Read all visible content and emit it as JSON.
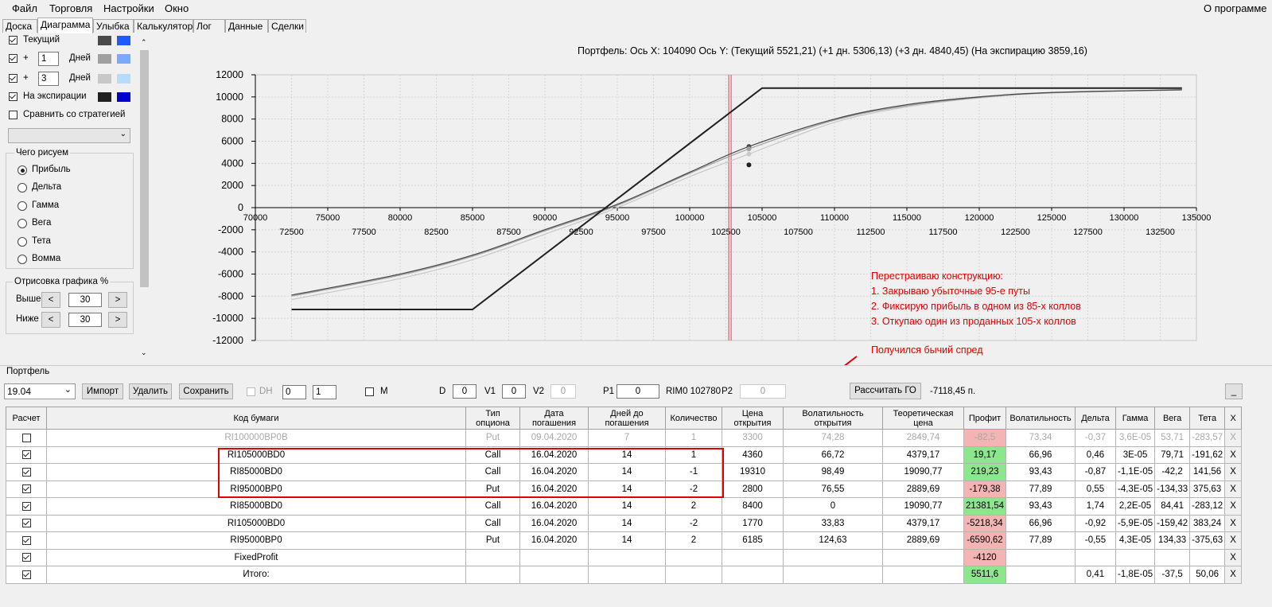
{
  "menu": {
    "file": "Файл",
    "trade": "Торговля",
    "settings": "Настройки",
    "window": "Окно",
    "about": "О программе"
  },
  "tabs": [
    "Доска",
    "Диаграмма",
    "Улыбка",
    "Калькулятор",
    "Лог",
    "Данные",
    "Сделки"
  ],
  "left": {
    "current_label": "Текущий",
    "plus": "+",
    "days1": "1",
    "days_label": "Дней",
    "days2": "3",
    "expiry_label": "На экспирации",
    "compare_label": "Сравнить со стратегией",
    "what_draw": "Чего рисуем",
    "radios": [
      "Прибыль",
      "Дельта",
      "Гамма",
      "Вега",
      "Тета",
      "Вомма"
    ],
    "render_pct": "Отрисовка графика %",
    "above_label": "Выше",
    "above_val": "30",
    "below_label": "Ниже",
    "below_val": "30",
    "lt": "<",
    "gt": ">",
    "colors": {
      "current_dark": "#4a4a4a",
      "current_light": "#1e5aff",
      "d1_dark": "#a0a0a0",
      "d1_light": "#7aaaff",
      "d3_dark": "#c8c8c8",
      "d3_light": "#b4dcff",
      "exp_dark": "#202020",
      "exp_light": "#0000d0"
    }
  },
  "chart_header": "Портфель: Ось X: 104090 Ось Y:  (Текущий 5521,21)  (+1 дн. 5306,13)  (+3 дн. 4840,45)  (На экспирацию 3859,16)",
  "annotation": {
    "lines": [
      "Перестраиваю конструкцию:",
      "1. Закрываю убыточные 95-е путы",
      "2. Фиксирую прибыль в одном из 85-х коллов",
      "3. Откупаю один из проданных 105-х коллов"
    ],
    "result": "Получился бычий спред"
  },
  "chart_data": {
    "type": "line",
    "xlim": [
      70000,
      135000
    ],
    "ylim": [
      -12000,
      12000
    ],
    "x_ticks_top": [
      "70000",
      "75000",
      "80000",
      "85000",
      "90000",
      "95000",
      "100000",
      "105000",
      "110000",
      "115000",
      "120000",
      "125000",
      "130000",
      "135000"
    ],
    "x_ticks_bottom": [
      "72500",
      "77500",
      "82500",
      "87500",
      "92500",
      "97500",
      "102500",
      "107500",
      "112500",
      "117500",
      "122500",
      "127500",
      "132500"
    ],
    "y_ticks": [
      "12000",
      "10000",
      "8000",
      "6000",
      "4000",
      "2000",
      "0",
      "-2000",
      "-4000",
      "-6000",
      "-8000",
      "-10000",
      "-12000"
    ],
    "series": [
      {
        "name": "На экспирации",
        "x": [
          72500,
          85000,
          105000,
          134000
        ],
        "y": [
          -9200,
          -9200,
          10800,
          10800
        ]
      },
      {
        "name": "Текущий",
        "x": [
          72500,
          80000,
          85000,
          90000,
          95000,
          100000,
          104090,
          110000,
          115000,
          120000,
          125000,
          134000
        ],
        "y": [
          -7900,
          -6000,
          -4300,
          -2000,
          300,
          3200,
          5521,
          8000,
          9300,
          10000,
          10400,
          10650
        ]
      },
      {
        "name": "+1 дн.",
        "x": [
          72500,
          80000,
          85000,
          90000,
          95000,
          100000,
          104090,
          110000,
          115000,
          120000,
          125000,
          134000
        ],
        "y": [
          -8000,
          -6100,
          -4400,
          -2100,
          200,
          3100,
          5306,
          7900,
          9200,
          9950,
          10380,
          10640
        ]
      },
      {
        "name": "+3 дн.",
        "x": [
          72500,
          80000,
          85000,
          90000,
          95000,
          100000,
          104090,
          110000,
          115000,
          120000,
          125000,
          134000
        ],
        "y": [
          -8300,
          -6400,
          -4700,
          -2400,
          0,
          2800,
          4840,
          7700,
          9100,
          9900,
          10350,
          10630
        ]
      }
    ],
    "cursor_x": 104090,
    "spot_line_x": 102780
  },
  "portfolio": {
    "title": "Портфель",
    "date": "19.04",
    "import": "Импорт",
    "delete": "Удалить",
    "save": "Сохранить",
    "dh": "DH",
    "dh_val1": "0",
    "dh_val2": "1",
    "m": "M",
    "d_label": "D",
    "d_val": "0",
    "v1_label": "V1",
    "v1_val": "0",
    "v2_label": "V2",
    "v2_val": "0",
    "p1_label": "P1",
    "p1_val": "0",
    "rim": "RIM0 102780",
    "p2_label": "P2",
    "p2_val": "0",
    "calc_go": "Рассчитать ГО",
    "go_val": "-7118,45 п.",
    "minimize": "_"
  },
  "table": {
    "headers": [
      "Расчет",
      "Код бумаги",
      "Тип опциона",
      "Дата погашения",
      "Дней до погашения",
      "Количество",
      "Цена открытия",
      "Волатильность открытия",
      "Теоретическая цена",
      "Профит",
      "Волатильность",
      "Дельта",
      "Гамма",
      "Вега",
      "Тета",
      "X"
    ],
    "rows": [
      {
        "checked": false,
        "faded": true,
        "code": "RI100000BP0B",
        "type": "Put",
        "date": "09.04.2020",
        "days": "7",
        "qty": "1",
        "price": "3300",
        "vol_open": "74,28",
        "theo": "2849,74",
        "profit": "-82,5",
        "profit_class": "red",
        "vol": "73,34",
        "delta": "-0,37",
        "gamma": "3,6E-05",
        "vega": "53,71",
        "theta": "-283,57"
      },
      {
        "checked": true,
        "faded": false,
        "code": "RI105000BD0",
        "type": "Call",
        "date": "16.04.2020",
        "days": "14",
        "qty": "1",
        "price": "4360",
        "vol_open": "66,72",
        "theo": "4379,17",
        "profit": "19,17",
        "profit_class": "green",
        "vol": "66,96",
        "delta": "0,46",
        "gamma": "3E-05",
        "vega": "79,71",
        "theta": "-191,62"
      },
      {
        "checked": true,
        "faded": false,
        "code": "RI85000BD0",
        "type": "Call",
        "date": "16.04.2020",
        "days": "14",
        "qty": "-1",
        "price": "19310",
        "vol_open": "98,49",
        "theo": "19090,77",
        "profit": "219,23",
        "profit_class": "green",
        "vol": "93,43",
        "delta": "-0,87",
        "gamma": "-1,1E-05",
        "vega": "-42,2",
        "theta": "141,56"
      },
      {
        "checked": true,
        "faded": false,
        "code": "RI95000BP0",
        "type": "Put",
        "date": "16.04.2020",
        "days": "14",
        "qty": "-2",
        "price": "2800",
        "vol_open": "76,55",
        "theo": "2889,69",
        "profit": "-179,38",
        "profit_class": "red",
        "vol": "77,89",
        "delta": "0,55",
        "gamma": "-4,3E-05",
        "vega": "-134,33",
        "theta": "375,63"
      },
      {
        "checked": true,
        "faded": false,
        "code": "RI85000BD0",
        "type": "Call",
        "date": "16.04.2020",
        "days": "14",
        "qty": "2",
        "price": "8400",
        "vol_open": "0",
        "theo": "19090,77",
        "profit": "21381,54",
        "profit_class": "green",
        "vol": "93,43",
        "delta": "1,74",
        "gamma": "2,2E-05",
        "vega": "84,41",
        "theta": "-283,12"
      },
      {
        "checked": true,
        "faded": false,
        "code": "RI105000BD0",
        "type": "Call",
        "date": "16.04.2020",
        "days": "14",
        "qty": "-2",
        "price": "1770",
        "vol_open": "33,83",
        "theo": "4379,17",
        "profit": "-5218,34",
        "profit_class": "red",
        "vol": "66,96",
        "delta": "-0,92",
        "gamma": "-5,9E-05",
        "vega": "-159,42",
        "theta": "383,24"
      },
      {
        "checked": true,
        "faded": false,
        "code": "RI95000BP0",
        "type": "Put",
        "date": "16.04.2020",
        "days": "14",
        "qty": "2",
        "price": "6185",
        "vol_open": "124,63",
        "theo": "2889,69",
        "profit": "-6590,62",
        "profit_class": "red",
        "vol": "77,89",
        "delta": "-0,55",
        "gamma": "4,3E-05",
        "vega": "134,33",
        "theta": "-375,63"
      },
      {
        "checked": true,
        "faded": false,
        "code": "FixedProfit",
        "type": "",
        "date": "",
        "days": "",
        "qty": "",
        "price": "",
        "vol_open": "",
        "theo": "",
        "profit": "-4120",
        "profit_class": "red",
        "vol": "",
        "delta": "",
        "gamma": "",
        "vega": "",
        "theta": ""
      },
      {
        "checked": true,
        "faded": false,
        "code": "Итого:",
        "type": "",
        "date": "",
        "days": "",
        "qty": "",
        "price": "",
        "vol_open": "",
        "theo": "",
        "profit": "5511,6",
        "profit_class": "green",
        "vol": "",
        "delta": "0,41",
        "gamma": "-1,8E-05",
        "vega": "-37,5",
        "theta": "50,06"
      }
    ],
    "x_label": "X"
  }
}
